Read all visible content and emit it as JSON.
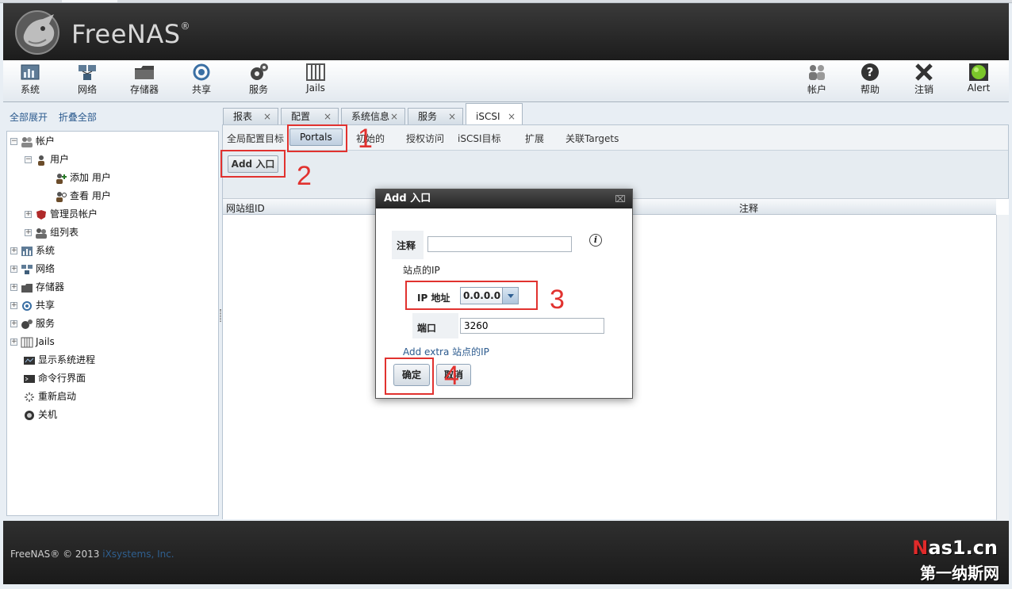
{
  "app": {
    "name": "FreeNAS",
    "registered": "®"
  },
  "toolbar": {
    "left": [
      {
        "label": "系统",
        "icon": "system-icon"
      },
      {
        "label": "网络",
        "icon": "network-icon"
      },
      {
        "label": "存储器",
        "icon": "storage-icon"
      },
      {
        "label": "共享",
        "icon": "share-icon"
      },
      {
        "label": "服务",
        "icon": "services-icon"
      },
      {
        "label": "Jails",
        "icon": "jails-icon"
      }
    ],
    "right": [
      {
        "label": "帐户",
        "icon": "account-icon"
      },
      {
        "label": "帮助",
        "icon": "help-icon"
      },
      {
        "label": "注销",
        "icon": "logout-icon"
      },
      {
        "label": "Alert",
        "icon": "alert-icon"
      }
    ]
  },
  "sidebar": {
    "expand_all": "全部展开",
    "collapse_all": "折叠全部",
    "tree": [
      {
        "label": "帐户",
        "level": 0,
        "expander": "−",
        "icon": "account-icon"
      },
      {
        "label": "用户",
        "level": 1,
        "expander": "−",
        "icon": "user-icon"
      },
      {
        "label": "添加 用户",
        "level": 2,
        "expander": "",
        "icon": "add-user-icon"
      },
      {
        "label": "查看 用户",
        "level": 2,
        "expander": "",
        "icon": "view-user-icon"
      },
      {
        "label": "管理员帐户",
        "level": 1,
        "expander": "+",
        "icon": "admin-icon"
      },
      {
        "label": "组列表",
        "level": 1,
        "expander": "+",
        "icon": "group-icon"
      },
      {
        "label": "系统",
        "level": 0,
        "expander": "+",
        "icon": "system-icon"
      },
      {
        "label": "网络",
        "level": 0,
        "expander": "+",
        "icon": "network-icon"
      },
      {
        "label": "存储器",
        "level": 0,
        "expander": "+",
        "icon": "storage-icon"
      },
      {
        "label": "共享",
        "level": 0,
        "expander": "+",
        "icon": "share-icon"
      },
      {
        "label": "服务",
        "level": 0,
        "expander": "+",
        "icon": "services-icon"
      },
      {
        "label": "Jails",
        "level": 0,
        "expander": "+",
        "icon": "jails-icon"
      },
      {
        "label": "显示系统进程",
        "level": 0,
        "expander": "",
        "icon": "process-icon"
      },
      {
        "label": "命令行界面",
        "level": 0,
        "expander": "",
        "icon": "shell-icon"
      },
      {
        "label": "重新启动",
        "level": 0,
        "expander": "",
        "icon": "reboot-icon"
      },
      {
        "label": "关机",
        "level": 0,
        "expander": "",
        "icon": "shutdown-icon"
      }
    ]
  },
  "tabs": [
    {
      "label": "报表",
      "close": "×"
    },
    {
      "label": "配置",
      "close": "×"
    },
    {
      "label": "系统信息",
      "close": "×"
    },
    {
      "label": "服务",
      "close": "×"
    },
    {
      "label": "iSCSI",
      "close": "×",
      "active": true
    }
  ],
  "subtabs": [
    {
      "label": "全局配置目标"
    },
    {
      "label": "Portals",
      "active": true
    },
    {
      "label": "初始的"
    },
    {
      "label": "授权访问"
    },
    {
      "label": "iSCSI目标"
    },
    {
      "label": "扩展"
    },
    {
      "label": "关联Targets"
    }
  ],
  "add_button": "Add 入口",
  "grid": {
    "columns": [
      "网站组ID",
      "注释"
    ]
  },
  "modal": {
    "title": "Add 入口",
    "close": "⌧",
    "comment_label": "注释",
    "comment_value": "",
    "section_label": "站点的IP",
    "ip_label": "IP 地址",
    "ip_value": "0.0.0.0",
    "port_label": "端口",
    "port_value": "3260",
    "add_extra": "Add extra 站点的IP",
    "ok": "确定",
    "cancel": "取消"
  },
  "footer": {
    "copyright": "FreeNAS® © 2013 ",
    "company": "iXsystems, Inc.",
    "watermark_top_red": "N",
    "watermark_top": "as1.cn",
    "watermark_bottom": "第一纳斯网"
  },
  "annotations": [
    "1",
    "2",
    "3",
    "4"
  ],
  "colors": {
    "annotation_red": "#e1322f",
    "header_bg": "#262626",
    "link_blue": "#2b5a8e"
  }
}
